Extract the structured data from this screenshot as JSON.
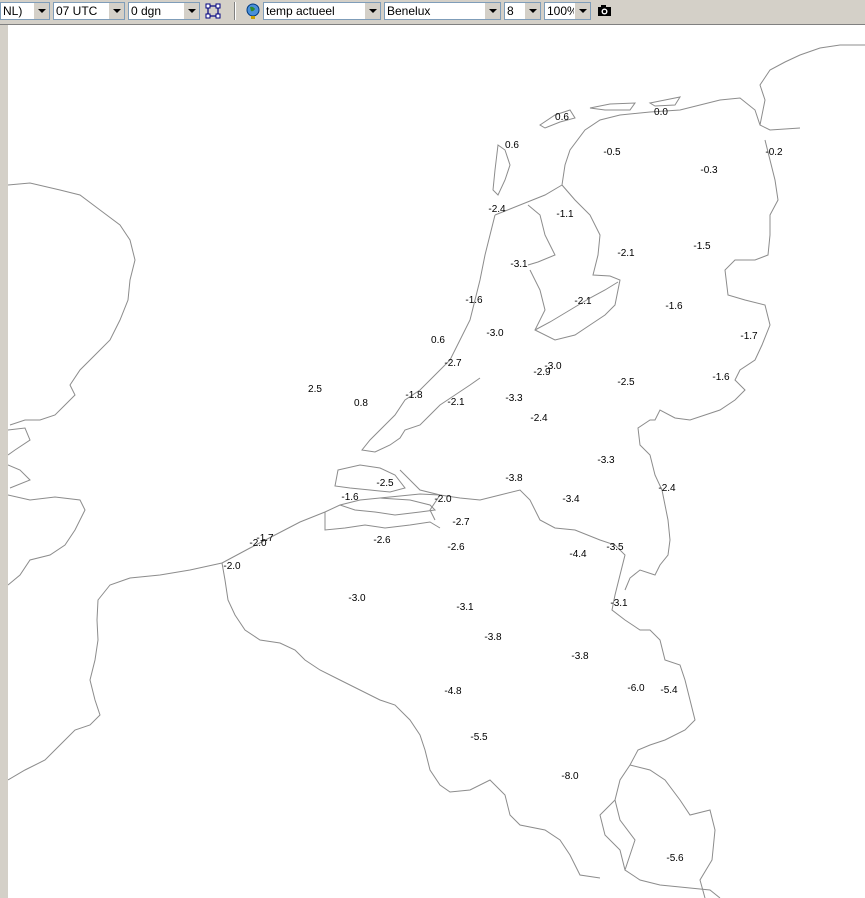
{
  "toolbar": {
    "region_code": "NL)",
    "time": "07 UTC",
    "days": "0 dgn",
    "parameter": "temp actueel",
    "area": "Benelux",
    "size": "8",
    "zoom": "100%"
  },
  "map": {
    "labels": [
      {
        "v": "0.6"
      },
      {
        "v": "0.0"
      },
      {
        "v": "0.6"
      },
      {
        "v": "-0.5"
      },
      {
        "v": "-0.2"
      },
      {
        "v": "-0.3"
      },
      {
        "v": "-2.4"
      },
      {
        "v": "-1.1"
      },
      {
        "v": "-2.1"
      },
      {
        "v": "-1.5"
      },
      {
        "v": "-3.1"
      },
      {
        "v": "-1.6"
      },
      {
        "v": "-2.1"
      },
      {
        "v": "-1.6"
      },
      {
        "v": "-3.0"
      },
      {
        "v": "0.6"
      },
      {
        "v": "-1.7"
      },
      {
        "v": "-2.7"
      },
      {
        "v": "-3.0"
      },
      {
        "v": "-2.9"
      },
      {
        "v": "-2.5"
      },
      {
        "v": "-1.6"
      },
      {
        "v": "2.5"
      },
      {
        "v": "-1.8"
      },
      {
        "v": "0.8"
      },
      {
        "v": "-2.1"
      },
      {
        "v": "-3.3"
      },
      {
        "v": "-2.4"
      },
      {
        "v": "-3.3"
      },
      {
        "v": "-3.8"
      },
      {
        "v": "-2.5"
      },
      {
        "v": "-2.4"
      },
      {
        "v": "-1.6"
      },
      {
        "v": "-2.0"
      },
      {
        "v": "-3.4"
      },
      {
        "v": "-2.7"
      },
      {
        "v": "-1.7"
      },
      {
        "v": "-2.0"
      },
      {
        "v": "-2.6"
      },
      {
        "v": "-2.6"
      },
      {
        "v": "-3.5"
      },
      {
        "v": "-4.4"
      },
      {
        "v": "-2.0"
      },
      {
        "v": "-3.0"
      },
      {
        "v": "-3.1"
      },
      {
        "v": "-3.1"
      },
      {
        "v": "-3.8"
      },
      {
        "v": "-3.8"
      },
      {
        "v": "-6.0"
      },
      {
        "v": "-5.4"
      },
      {
        "v": "-4.8"
      },
      {
        "v": "-5.5"
      },
      {
        "v": "-8.0"
      },
      {
        "v": "-5.6"
      }
    ]
  }
}
